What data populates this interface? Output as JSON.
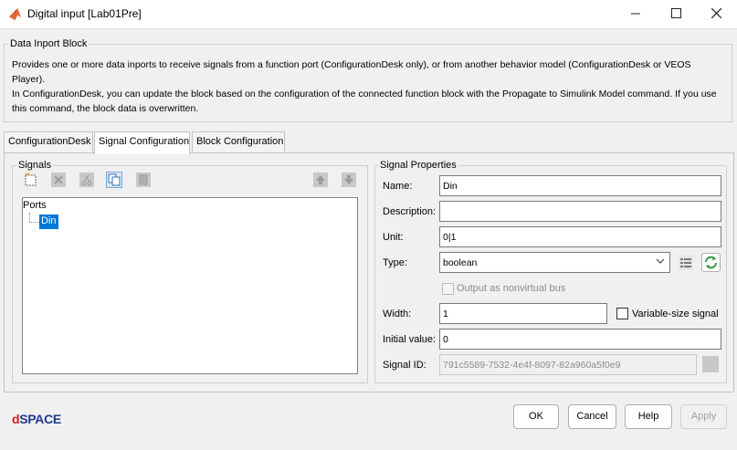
{
  "window": {
    "title": "Digital input [Lab01Pre]"
  },
  "block_group": {
    "title": "Data Inport Block",
    "description": [
      "Provides one or more data inports to receive signals from a function port (ConfigurationDesk only), or from another behavior model (ConfigurationDesk or VEOS Player).",
      "In ConfigurationDesk, you can update the block based on the configuration of the connected function block with the Propagate to Simulink Model command. If you use this command, the block data is overwritten."
    ]
  },
  "tabs": [
    {
      "label": "ConfigurationDesk",
      "active": false
    },
    {
      "label": "Signal Configuration",
      "active": true
    },
    {
      "label": "Block Configuration",
      "active": false
    }
  ],
  "signals": {
    "title": "Signals",
    "toolbar": [
      "new-signal-icon",
      "delete-icon",
      "cut-icon",
      "copy-icon",
      "paste-icon",
      "move-up-icon",
      "move-down-icon"
    ],
    "tree": {
      "root": "Ports",
      "items": [
        {
          "label": "Din",
          "selected": true
        }
      ]
    }
  },
  "signal_properties": {
    "title": "Signal Properties",
    "name_label": "Name:",
    "name_value": "Din",
    "description_label": "Description:",
    "description_value": "",
    "unit_label": "Unit:",
    "unit_value": "0|1",
    "type_label": "Type:",
    "type_value": "boolean",
    "nonvirtual_label": "Output as nonvirtual bus",
    "nonvirtual_checked": false,
    "width_label": "Width:",
    "width_value": "1",
    "variable_size_label": "Variable-size signal",
    "variable_size_checked": false,
    "initial_value_label": "Initial value:",
    "initial_value_value": "0",
    "signal_id_label": "Signal ID:",
    "signal_id_value": "791c5589-7532-4e4f-8097-82a960a5f0e9"
  },
  "footer": {
    "brand_prefix": "d",
    "brand_rest": "SPACE",
    "ok_label": "OK",
    "cancel_label": "Cancel",
    "help_label": "Help",
    "apply_label": "Apply"
  },
  "colors": {
    "selection": "#0078d7",
    "brand_blue": "#1f3a93",
    "brand_red": "#d41c1c",
    "refresh_green": "#2e9a3a"
  }
}
